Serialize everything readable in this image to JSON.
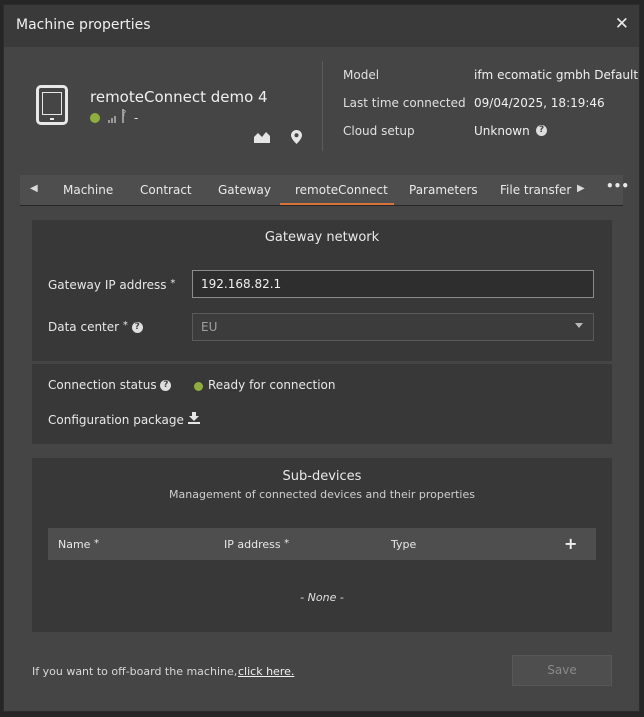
{
  "dialog": {
    "title": "Machine properties",
    "close_glyph": "✕"
  },
  "machine": {
    "name": "remoteConnect demo 4",
    "status_color": "#8fae3d",
    "signal_text": "-",
    "icons": [
      "tablet-icon",
      "signal-icon",
      "chart-icon",
      "location-pin-icon"
    ]
  },
  "info": {
    "model_label": "Model",
    "model_value": "ifm ecomatic gmbh Default",
    "last_label": "Last time connected",
    "last_value": "09/04/2025, 18:19:46",
    "cloud_label": "Cloud setup",
    "cloud_value": "Unknown"
  },
  "tabs": [
    {
      "label": "Machine"
    },
    {
      "label": "Contract"
    },
    {
      "label": "Gateway"
    },
    {
      "label": "remoteConnect",
      "active": true
    },
    {
      "label": "Parameters"
    },
    {
      "label": "File transfer"
    }
  ],
  "tabs_more": "•••",
  "accent_color": "#d8743c",
  "gateway": {
    "title": "Gateway network",
    "ip_label": "Gateway IP address",
    "ip_value": "192.168.82.1",
    "dc_label": "Data center",
    "dc_value": "EU",
    "required_mark": "*"
  },
  "connection": {
    "status_label": "Connection status",
    "status_value": "Ready for connection",
    "config_label": "Configuration package"
  },
  "subdevices": {
    "title": "Sub-devices",
    "description": "Management of connected devices and their properties",
    "columns": [
      "Name",
      "IP address",
      "Type"
    ],
    "empty_text": "- None -"
  },
  "footer": {
    "offboard_text": "If you want to off-board the machine,",
    "offboard_link": "click here.",
    "save_label": "Save"
  }
}
